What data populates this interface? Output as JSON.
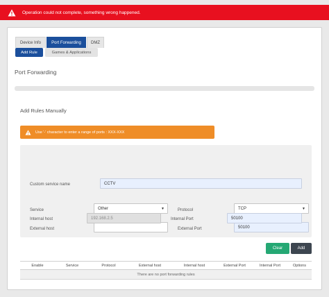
{
  "error": {
    "message": "Operation could not complete, something wrong happened."
  },
  "tabs": [
    {
      "label": "Device Info",
      "active": false
    },
    {
      "label": "Port Forwarding",
      "active": true
    },
    {
      "label": "DMZ",
      "active": false
    }
  ],
  "subtabs": [
    {
      "label": "Add Rule",
      "active": true
    },
    {
      "label": "Games & Applications",
      "active": false
    }
  ],
  "page_title": "Port Forwarding",
  "section_title": "Add Rules Manually",
  "hint": "Use '-' character to enter a range of ports : XXX-XXX",
  "form": {
    "custom_service_label": "Custom service name",
    "custom_service_value": "CCTV",
    "service_label": "Service",
    "service_value": "Other",
    "protocol_label": "Protocol",
    "protocol_value": "TCP",
    "external_host_label": "External host",
    "external_host_value": "",
    "external_port_label": "External Port",
    "external_port_value": "50100",
    "internal_host_label": "Internal host",
    "internal_host_value": "192.168.2.5",
    "internal_port_label": "Internal Port",
    "internal_port_value": "50100"
  },
  "buttons": {
    "clear": "Clear",
    "add": "Add"
  },
  "table": {
    "columns": [
      "Enable",
      "Service",
      "Protocol",
      "External host",
      "Internal host",
      "External Port",
      "Internal Port",
      "Options"
    ],
    "empty_message": "There are no port forwarding rules"
  },
  "colors": {
    "error": "#e8101f",
    "primary": "#1b4f9c",
    "warning": "#ef8d27",
    "clear": "#25a874",
    "add": "#3d4650"
  }
}
